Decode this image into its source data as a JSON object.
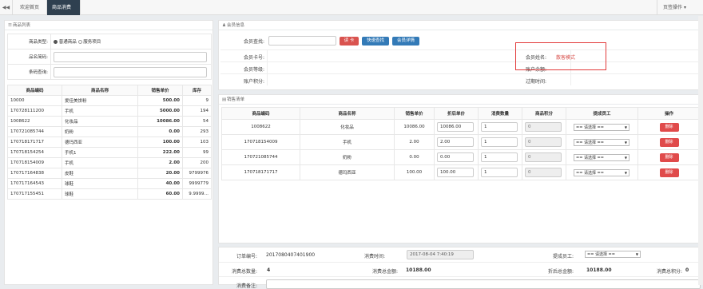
{
  "tabs": {
    "back_glyph": "◀◀",
    "home_label": "欢迎首页",
    "active_label": "商品消费",
    "close_glyph": "×",
    "right_label": "页签操作",
    "right_caret": "▾"
  },
  "left_panel": {
    "title": "商品列表",
    "type_label": "商品类型:",
    "type_option_1": "普通商品",
    "type_option_2": "服务项目",
    "code_label": "品名简码:",
    "barcode_label": "条码查询:",
    "columns": [
      "商品编码",
      "商品名称",
      "销售单价",
      "库存"
    ],
    "rows": [
      [
        "10000",
        "爱佳美饼粉",
        "500.00",
        "9"
      ],
      [
        "170728111200",
        "手机",
        "5000.00",
        "194"
      ],
      [
        "1008622",
        "化妆品",
        "10086.00",
        "54"
      ],
      [
        "170721085744",
        "奶粉",
        "0.00",
        "293"
      ],
      [
        "170718171717",
        "德玛西亚",
        "100.00",
        "103"
      ],
      [
        "170718154254",
        "手机1",
        "222.00",
        "99"
      ],
      [
        "170718154009",
        "手机",
        "2.00",
        "200"
      ],
      [
        "170717164838",
        "皮鞋",
        "20.00",
        "9799976"
      ],
      [
        "170717164543",
        "球鞋",
        "40.00",
        "9999779"
      ],
      [
        "170717155451",
        "球鞋",
        "60.00",
        "9.9999…"
      ]
    ]
  },
  "member_panel": {
    "title": "会员信息",
    "search_label": "会员查找:",
    "read_card_btn": "读 卡",
    "quick_search_btn": "快速查找",
    "detail_btn": "会员详情",
    "card_label": "会员卡号:",
    "level_label": "会员等级:",
    "points_label": "账户积分:",
    "name_label": "会员姓名:",
    "name_value": "散客模式",
    "balance_label": "账户余额:",
    "expire_label": "过期时间:",
    "colors": {
      "danger": "#d9534f",
      "primary": "#337ab7",
      "highlight_box": "#e23a3a"
    }
  },
  "sales_panel": {
    "title": "销售清单",
    "columns": [
      "商品编码",
      "商品名称",
      "销售单价",
      "折后单价",
      "消费数量",
      "商品积分",
      "提成员工",
      "操作"
    ],
    "rows": [
      {
        "code": "1008622",
        "name": "化妆品",
        "price": "10086.00",
        "discount": "10086.00",
        "qty": "1",
        "points": "0"
      },
      {
        "code": "170718154009",
        "name": "手机",
        "price": "2.00",
        "discount": "2.00",
        "qty": "1",
        "points": "0"
      },
      {
        "code": "170721085744",
        "name": "奶粉",
        "price": "0.00",
        "discount": "0.00",
        "qty": "1",
        "points": "0"
      },
      {
        "code": "170718171717",
        "name": "德玛西亚",
        "price": "100.00",
        "discount": "100.00",
        "qty": "1",
        "points": "0"
      }
    ],
    "employee_select": "== 请选择 ==",
    "delete_btn": "删除"
  },
  "footer": {
    "order_no_label": "订单编号:",
    "order_no_value": "2017080407401900",
    "time_label": "消费时间:",
    "time_value": "2017-08-04 7:40:19",
    "staff_label": "提成员工:",
    "staff_select": "== 请选择 ==",
    "total_qty_label": "消费总数量:",
    "total_qty_value": "4",
    "total_amount_label": "消费总金额:",
    "total_amount_value": "10188.00",
    "discount_total_label": "折后总金额:",
    "discount_total_value": "10188.00",
    "total_points_label": "消费总积分:",
    "total_points_value": "0",
    "remark_label": "消费备注:"
  }
}
